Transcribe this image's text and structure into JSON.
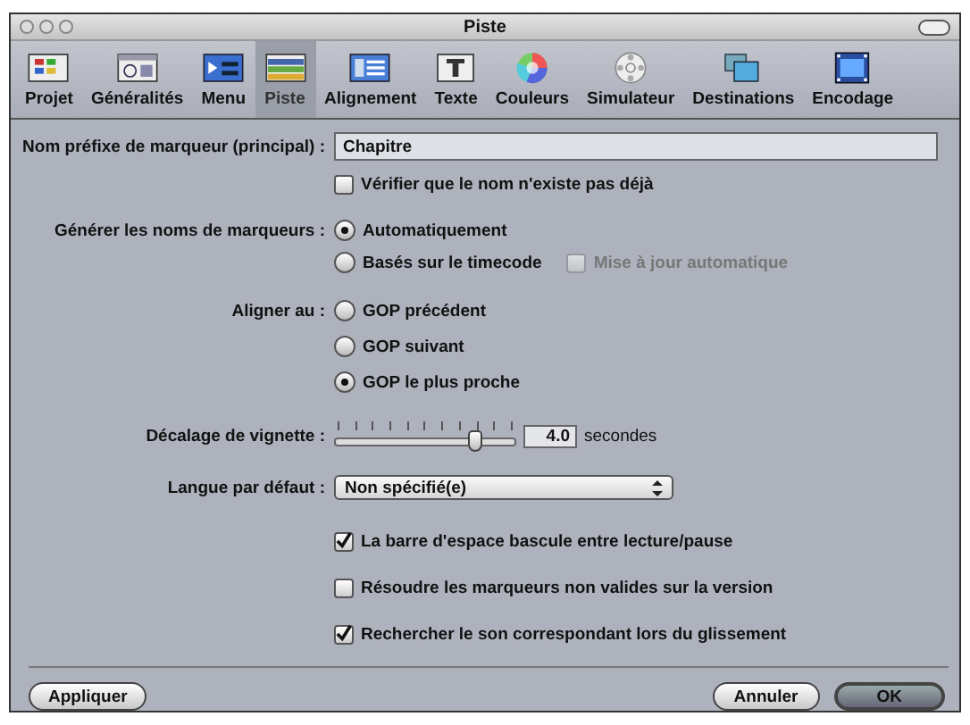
{
  "window": {
    "title": "Piste"
  },
  "toolbar": [
    {
      "label": "Projet",
      "selected": false
    },
    {
      "label": "Généralités",
      "selected": false
    },
    {
      "label": "Menu",
      "selected": false
    },
    {
      "label": "Piste",
      "selected": true
    },
    {
      "label": "Alignement",
      "selected": false
    },
    {
      "label": "Texte",
      "selected": false
    },
    {
      "label": "Couleurs",
      "selected": false
    },
    {
      "label": "Simulateur",
      "selected": false
    },
    {
      "label": "Destinations",
      "selected": false
    },
    {
      "label": "Encodage",
      "selected": false
    }
  ],
  "marker_prefix": {
    "label": "Nom préfixe de marqueur (principal) :",
    "value": "Chapitre"
  },
  "verify_unique": {
    "label": "Vérifier que le nom n'existe pas déjà",
    "checked": false
  },
  "generate_names": {
    "label": "Générer les noms de marqueurs :",
    "options": [
      {
        "label": "Automatiquement",
        "selected": true
      },
      {
        "label": "Basés sur le timecode",
        "selected": false
      }
    ],
    "auto_update": {
      "label": "Mise à jour automatique",
      "checked": false,
      "disabled": true
    }
  },
  "align": {
    "label": "Aligner au :",
    "options": [
      {
        "label": "GOP précédent",
        "selected": false
      },
      {
        "label": "GOP suivant",
        "selected": false
      },
      {
        "label": "GOP le plus proche",
        "selected": true
      }
    ]
  },
  "thumbnail_offset": {
    "label": "Décalage de vignette :",
    "level": 0.78,
    "value": "4.0",
    "unit": "secondes"
  },
  "default_language": {
    "label": "Langue par défaut :",
    "value": "Non spécifié(e)"
  },
  "options": [
    {
      "label": "La barre d'espace bascule entre lecture/pause",
      "checked": true
    },
    {
      "label": "Résoudre les marqueurs non valides sur la version",
      "checked": false
    },
    {
      "label": "Rechercher le son correspondant lors du glissement",
      "checked": true
    }
  ],
  "buttons_left": [
    {
      "label": "Appliquer",
      "default": false
    }
  ],
  "buttons_right": [
    {
      "label": "Annuler",
      "default": false
    },
    {
      "label": "OK",
      "default": true
    }
  ]
}
